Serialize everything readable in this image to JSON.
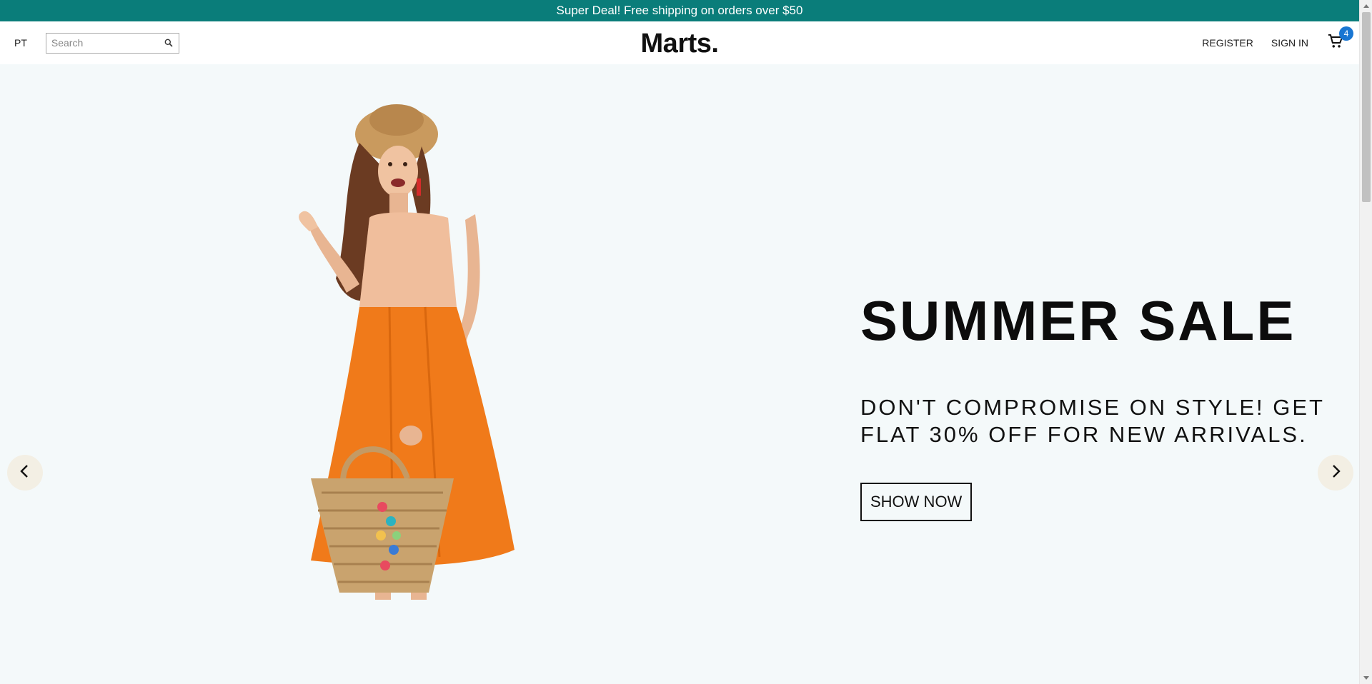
{
  "announcement": {
    "text": "Super Deal! Free shipping on orders over $50"
  },
  "header": {
    "language": "PT",
    "search": {
      "placeholder": "Search",
      "value": ""
    },
    "logo": "Marts.",
    "register_label": "REGISTER",
    "signin_label": "SIGN IN",
    "cart_count": "4"
  },
  "hero": {
    "title": "SUMMER SALE",
    "description": "DON'T COMPROMISE ON STYLE! GET FLAT 30% OFF FOR NEW ARRIVALS.",
    "button_label": "SHOW NOW"
  },
  "icons": {
    "search": "search-icon",
    "cart": "cart-icon",
    "prev": "chevron-left-icon",
    "next": "chevron-right-icon"
  },
  "colors": {
    "announcement_bg": "#0a7d7a",
    "hero_bg": "#f4f9fa",
    "cart_badge": "#1976d2",
    "arrow_bg": "#f3efe4",
    "skirt": "#f07a1a"
  }
}
